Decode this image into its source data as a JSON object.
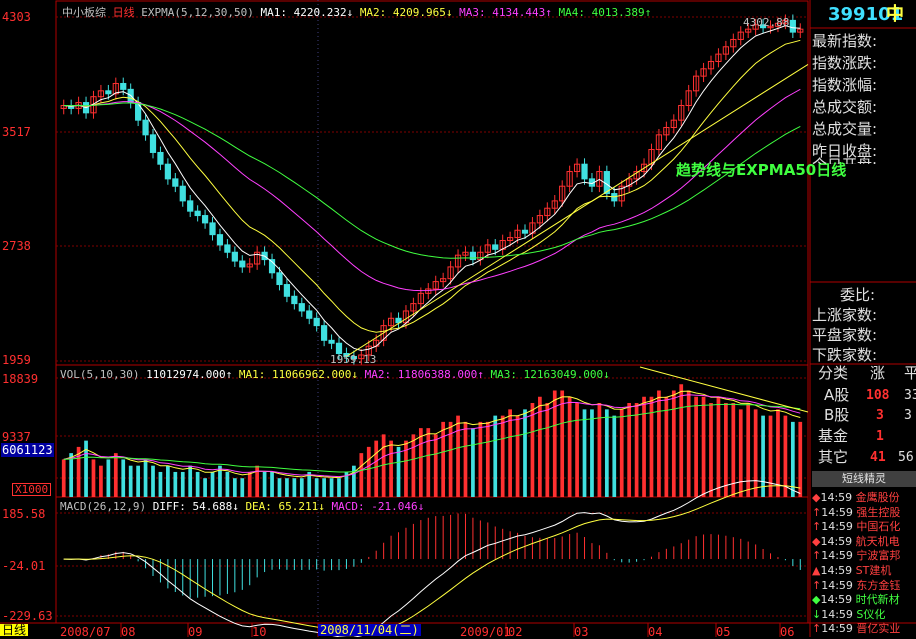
{
  "main_header": {
    "name": "中小板综",
    "period": "日线",
    "expma": "EXPMA(5,12,30,50)",
    "ma1": "MA1: 4220.232↓",
    "ma2": "MA2: 4209.965↓",
    "ma3": "MA3: 4134.443↑",
    "ma4": "MA4: 4013.389↑"
  },
  "price_axis": [
    "4303",
    "3517",
    "2738",
    "1959"
  ],
  "price_high_label": "4302.88",
  "price_low_label": "1959.13",
  "annotation": "趋势线与EXPMA50日线",
  "vol_header": {
    "name": "VOL(5,10,30)",
    "value": "11012974.000↑",
    "ma1": "MA1: 11066962.000↓",
    "ma2": "MA2: 11806388.000↑",
    "ma3": "MA3: 12163049.000↓"
  },
  "vol_axis": [
    "18839",
    "9337",
    "6061123",
    "X1000"
  ],
  "macd_header": {
    "name": "MACD(26,12,9)",
    "diff": "DIFF: 54.688↓",
    "dea": "DEA: 65.211↓",
    "macd": "MACD: -21.046↓"
  },
  "macd_axis": [
    "185.58",
    "-24.01",
    "-229.63"
  ],
  "date_axis": [
    "2008/07",
    "08",
    "09",
    "10",
    "2008/11/04(二)",
    "2009/01",
    "02",
    "03",
    "04",
    "05",
    "06"
  ],
  "date_left_tab": "日线",
  "right_panel": {
    "code": "399101",
    "name_char": "中",
    "fields": [
      "最新指数:",
      "指数涨跌:",
      "指数涨幅:",
      "总成交额:",
      "总成交量:",
      "昨日收盘:",
      "今日开盘:"
    ],
    "fields2": [
      "委比:",
      "上涨家数:",
      "平盘家数:",
      "下跌家数:"
    ],
    "table_header": [
      "分类",
      "涨",
      "平"
    ],
    "table_rows": [
      {
        "cat": "A股",
        "up": "108",
        "flat": "33"
      },
      {
        "cat": "B股",
        "up": "3",
        "flat": "3"
      },
      {
        "cat": "基金",
        "up": "1",
        "flat": ""
      },
      {
        "cat": "其它",
        "up": "41",
        "flat": "56"
      }
    ],
    "sprite_title": "短线精灵",
    "sprite_items": [
      {
        "mark": "◆",
        "time": "14:59",
        "name": "金鹰股份",
        "color": "#ff4040"
      },
      {
        "mark": "↑",
        "time": "14:59",
        "name": "强生控股",
        "color": "#ff4040"
      },
      {
        "mark": "↑",
        "time": "14:59",
        "name": "中国石化",
        "color": "#ff4040"
      },
      {
        "mark": "◆",
        "time": "14:59",
        "name": "航天机电",
        "color": "#ff4040"
      },
      {
        "mark": "↑",
        "time": "14:59",
        "name": "宁波富邦",
        "color": "#ff4040"
      },
      {
        "mark": "▲",
        "time": "14:59",
        "name": "ST建机",
        "color": "#ff4040"
      },
      {
        "mark": "↑",
        "time": "14:59",
        "name": "东方金钰",
        "color": "#ff4040"
      },
      {
        "mark": "◆",
        "time": "14:59",
        "name": "时代新材",
        "color": "#40ff40"
      },
      {
        "mark": "↓",
        "time": "14:59",
        "name": "S仪化",
        "color": "#40ff40"
      },
      {
        "mark": "↑",
        "time": "14:59",
        "name": "晋亿实业",
        "color": "#ff4040"
      }
    ]
  },
  "colors": {
    "up": "#ff3030",
    "down": "#40e0e0",
    "ma_white": "#ffffff",
    "ma_yellow": "#ffff40",
    "ma_magenta": "#ff40ff",
    "ma_green": "#40ff40",
    "grid": "#800000",
    "accent_code": "#40e0ff"
  },
  "chart_data": {
    "type": "line",
    "series": [],
    "ylim": [
      1959,
      4303
    ],
    "candles_close": [
      3700,
      3680,
      3720,
      3650,
      3760,
      3800,
      3780,
      3850,
      3810,
      3720,
      3600,
      3500,
      3380,
      3300,
      3200,
      3150,
      3050,
      2980,
      2950,
      2900,
      2820,
      2750,
      2700,
      2640,
      2600,
      2620,
      2700,
      2650,
      2560,
      2480,
      2400,
      2350,
      2300,
      2250,
      2200,
      2100,
      2080,
      2010,
      1990,
      1975,
      2000,
      2060,
      2100,
      2200,
      2250,
      2220,
      2300,
      2350,
      2420,
      2450,
      2500,
      2520,
      2600,
      2680,
      2700,
      2650,
      2700,
      2750,
      2720,
      2780,
      2800,
      2850,
      2830,
      2900,
      2950,
      3000,
      3050,
      3150,
      3250,
      3300,
      3200,
      3150,
      3250,
      3100,
      3050,
      3150,
      3200,
      3250,
      3300,
      3400,
      3500,
      3550,
      3600,
      3700,
      3800,
      3900,
      3950,
      4000,
      4050,
      4100,
      4150,
      4200,
      4220,
      4250,
      4230,
      4240,
      4260,
      4280,
      4200,
      4220
    ],
    "volumes": [
      6,
      7,
      8,
      9,
      6,
      5,
      6,
      7,
      6,
      5,
      5,
      6,
      5,
      4,
      5,
      4,
      4,
      5,
      4,
      3,
      4,
      5,
      4,
      3,
      3,
      4,
      5,
      4,
      4,
      3,
      3,
      3,
      3,
      4,
      3,
      3,
      3,
      3,
      4,
      5,
      7,
      8,
      9,
      10,
      9,
      8,
      9,
      10,
      11,
      11,
      10,
      12,
      12,
      13,
      12,
      11,
      12,
      12,
      13,
      13,
      14,
      13,
      14,
      15,
      16,
      15,
      17,
      17,
      16,
      15,
      14,
      14,
      15,
      14,
      13,
      14,
      15,
      15,
      16,
      16,
      17,
      16,
      17,
      18,
      17,
      16,
      16,
      15,
      16,
      15,
      15,
      14,
      15,
      14,
      13,
      13,
      14,
      13,
      12,
      12
    ]
  }
}
